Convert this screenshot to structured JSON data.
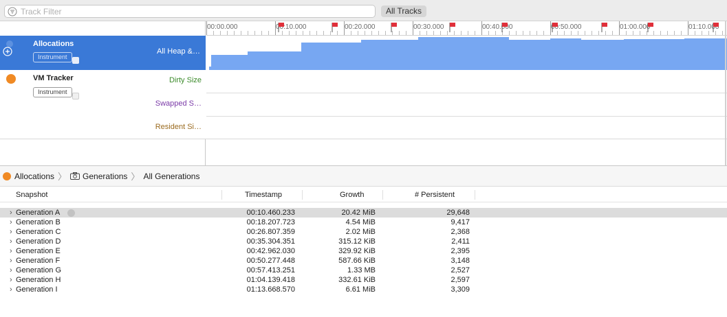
{
  "filter": {
    "placeholder": "Track Filter",
    "scope_button": "All Tracks"
  },
  "ruler": {
    "ticks": [
      "00:00.000",
      "00:10.000",
      "00:20.000",
      "00:30.000",
      "00:40.000",
      "00:50.000",
      "01:00.000",
      "01:10.000"
    ]
  },
  "tracks": {
    "allocations": {
      "name": "Allocations",
      "badge": "Instrument",
      "series": "All Heap &…"
    },
    "vm_tracker": {
      "name": "VM Tracker",
      "badge": "Instrument",
      "series": [
        {
          "label": "Dirty Size",
          "color": "#3b8a2a"
        },
        {
          "label": "Swapped S…",
          "color": "#7b3aa8"
        },
        {
          "label": "Resident Si…",
          "color": "#9a6a1e"
        }
      ]
    }
  },
  "colors": {
    "accent": "#3a79d7",
    "graph_fill": "#77a7f2",
    "flag": "#e0303a",
    "instrument_icon": "#f08a24"
  },
  "breadcrumb": [
    "Allocations",
    "Generations",
    "All Generations"
  ],
  "table": {
    "columns": [
      "Snapshot",
      "Timestamp",
      "Growth",
      "# Persistent"
    ],
    "rows": [
      {
        "name": "Generation A",
        "timestamp": "00:10.460.233",
        "growth": "20.42 MiB",
        "persistent": "29,648",
        "selected": true
      },
      {
        "name": "Generation B",
        "timestamp": "00:18.207.723",
        "growth": "4.54 MiB",
        "persistent": "9,417"
      },
      {
        "name": "Generation C",
        "timestamp": "00:26.807.359",
        "growth": "2.02 MiB",
        "persistent": "2,368"
      },
      {
        "name": "Generation D",
        "timestamp": "00:35.304.351",
        "growth": "315.12 KiB",
        "persistent": "2,411"
      },
      {
        "name": "Generation E",
        "timestamp": "00:42.962.030",
        "growth": "329.92 KiB",
        "persistent": "2,395"
      },
      {
        "name": "Generation F",
        "timestamp": "00:50.277.448",
        "growth": "587.66 KiB",
        "persistent": "3,148"
      },
      {
        "name": "Generation G",
        "timestamp": "00:57.413.251",
        "growth": "1.33 MB",
        "persistent": "2,527"
      },
      {
        "name": "Generation H",
        "timestamp": "01:04.139.418",
        "growth": "332.61 KiB",
        "persistent": "2,597"
      },
      {
        "name": "Generation I",
        "timestamp": "01:13.668.570",
        "growth": "6.61 MiB",
        "persistent": "3,309"
      }
    ]
  }
}
